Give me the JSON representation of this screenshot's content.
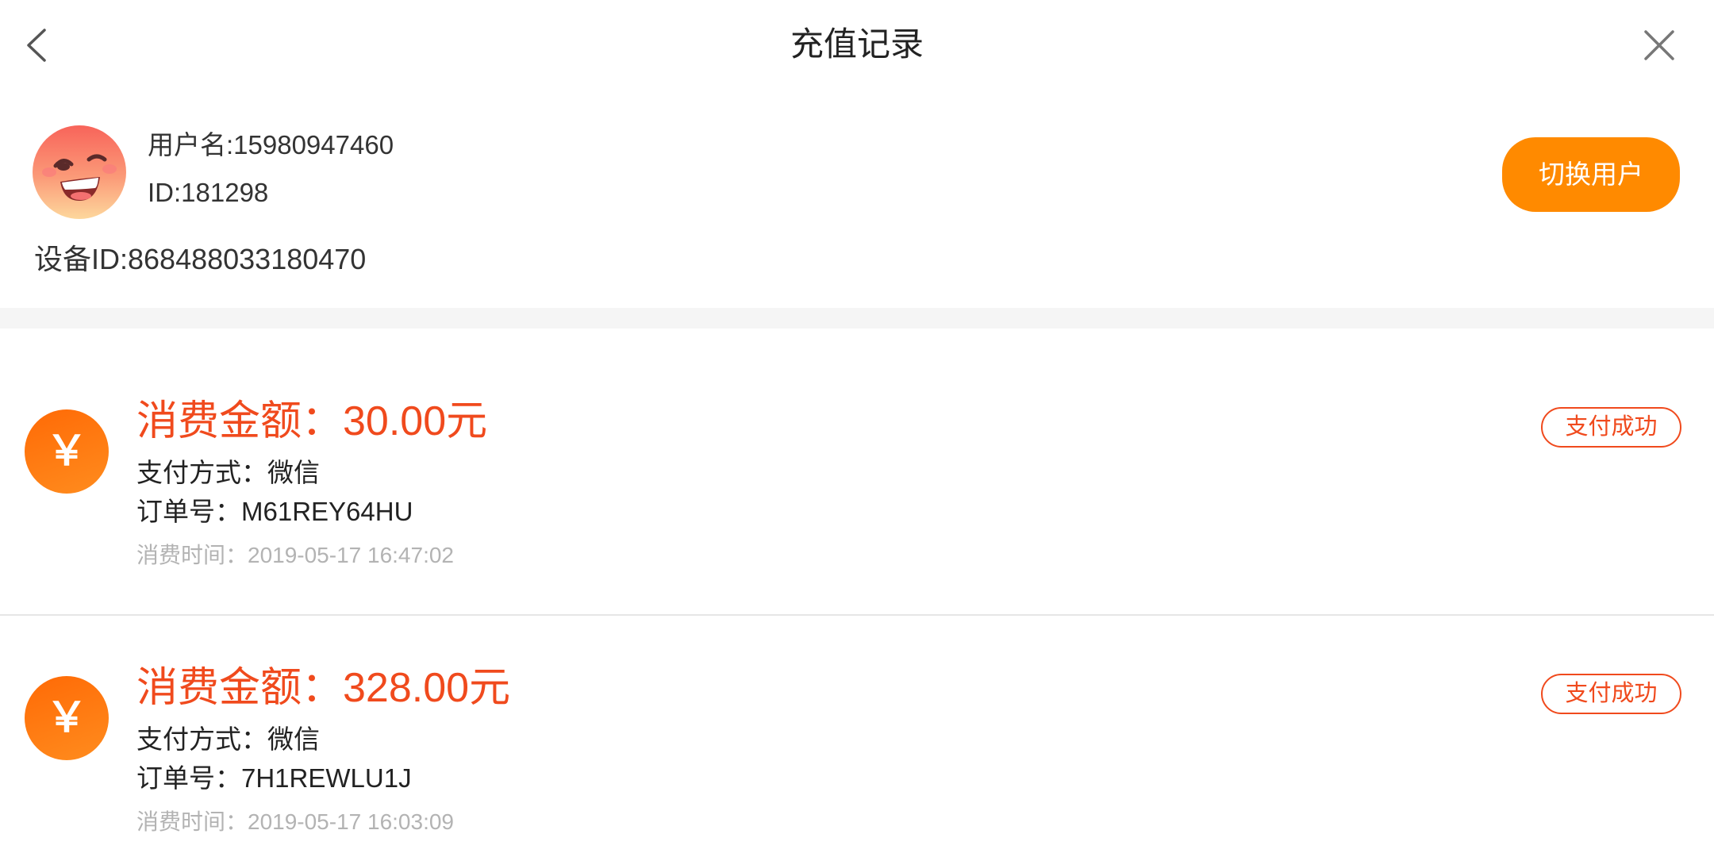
{
  "header": {
    "title": "充值记录",
    "back_icon": "chevron-left-icon",
    "close_icon": "close-icon"
  },
  "user": {
    "avatar_icon": "winking-face-avatar",
    "username": "用户名:15980947460",
    "id": "ID:181298",
    "device_id": "设备ID:868488033180470",
    "switch_button": "切换用户"
  },
  "records": [
    {
      "icon": "￥",
      "icon_name": "yen-icon",
      "amount_label": "消费金额：",
      "amount_value": "30.00元",
      "payment_method": "支付方式：微信",
      "order_no": "订单号：M61REY64HU",
      "time": "消费时间：2019-05-17 16:47:02",
      "status": "支付成功"
    },
    {
      "icon": "￥",
      "icon_name": "yen-icon",
      "amount_label": "消费金额：",
      "amount_value": "328.00元",
      "payment_method": "支付方式：微信",
      "order_no": "订单号：7H1REWLU1J",
      "time": "消费时间：2019-05-17 16:03:09",
      "status": "支付成功"
    }
  ],
  "colors": {
    "accent": "#ff8a00",
    "amount": "#f04a1d",
    "status": "#f04a1d",
    "muted": "#b3b3b3"
  }
}
